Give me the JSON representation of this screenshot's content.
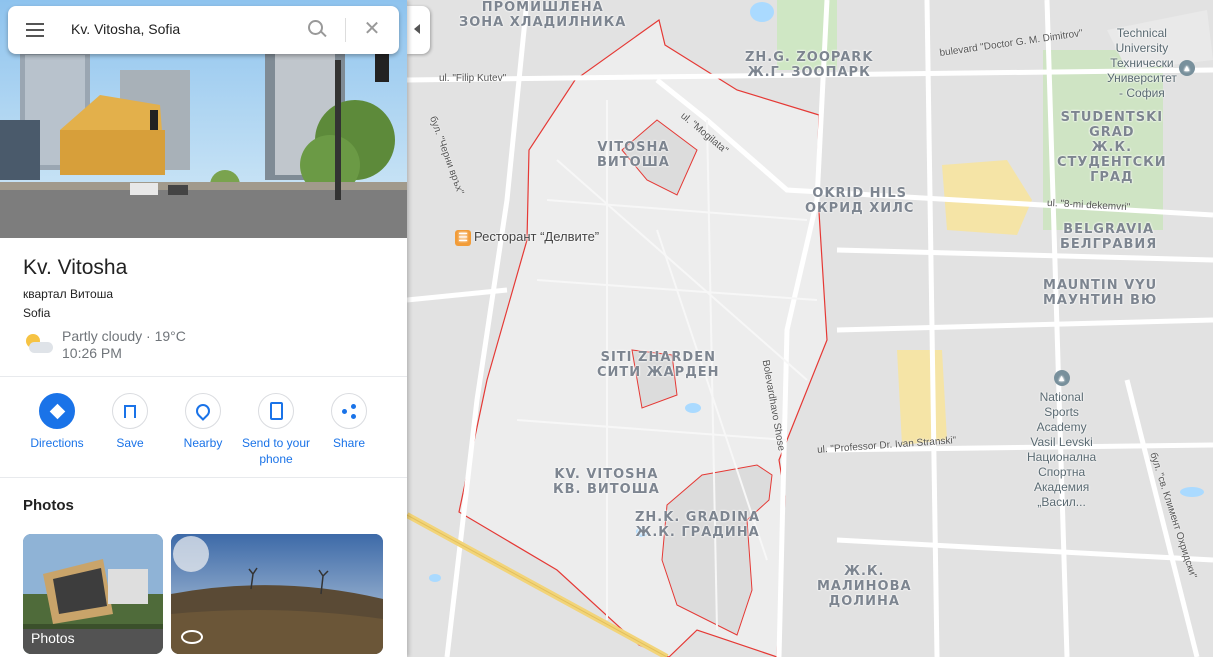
{
  "search": {
    "value": "Kv. Vitosha, Sofia"
  },
  "place": {
    "title": "Kv. Vitosha",
    "subtitle": "квартал Витоша",
    "city": "Sofia",
    "weather": {
      "condition": "Partly cloudy · 19°C",
      "time": "10:26 PM"
    }
  },
  "actions": [
    {
      "label": "Directions",
      "icon": "directions-icon"
    },
    {
      "label": "Save",
      "icon": "bookmark-icon"
    },
    {
      "label": "Nearby",
      "icon": "nearby-icon"
    },
    {
      "label": "Send to your phone",
      "icon": "send-to-phone-icon"
    },
    {
      "label": "Share",
      "icon": "share-icon"
    }
  ],
  "photos": {
    "heading": "Photos",
    "tile1_label": "Photos"
  },
  "map_labels": {
    "promishlena": "ПРОМИШЛЕНА\nЗОНА ХЛАДИЛНИКА",
    "zoopark": "ZH.G. ZOOPARK\nЖ.Г. ЗООПАРК",
    "vitosha_small": "VITOSHA\nВИТОША",
    "okrid": "OKRID HILS\nОКРИД ХИЛС",
    "studentski": "STUDENTSKI\nGRAD\nЖ.К.\nСТУДЕНТСКИ\nГРАД",
    "belgravia": "BELGRAVIA\nБЕЛГРАВИЯ",
    "mauntin": "MAUNTIN VYU\nМАУНТИН ВЮ",
    "siti": "SITI ZHARDEN\nСИТИ ЖАРДЕН",
    "kv_vitosha": "KV. VITOSHA\nКВ. ВИТОША",
    "gradina": "ZH.K. GRADINA\nЖ.К. ГРАДИНА",
    "malinova": "Ж.К.\nМАЛИНОВА\nДОЛИНА",
    "restaurant": "Ресторант “Делвите”",
    "tech_uni": "Technical\nUniversity\nТехнически\nУниверситет\n- София",
    "nsa": "National\nSports\nAcademy\nVasil Levski\nНационална\nСпортна\nАкадемия\n„Васил..."
  },
  "road_labels": {
    "filip": "ul. \"Filip Kutev\"",
    "dimitrov": "bulevard \"Doctor G. M. Dimitrov\"",
    "moglata": "ul. \"Mogilata\"",
    "cherni": "бул. \"Черни връх\"",
    "dekemvri": "ul. \"8-mi dekemvri\"",
    "stranski": "ul. \"Professor Dr. Ivan Stranski\"",
    "boyansko": "Bolevardhavo Shose",
    "ohridski": "бул. \"св. Климент Охридски\""
  },
  "colors": {
    "accent": "#1a73e8",
    "boundary": "#e53935",
    "road_major": "#f2d479"
  }
}
